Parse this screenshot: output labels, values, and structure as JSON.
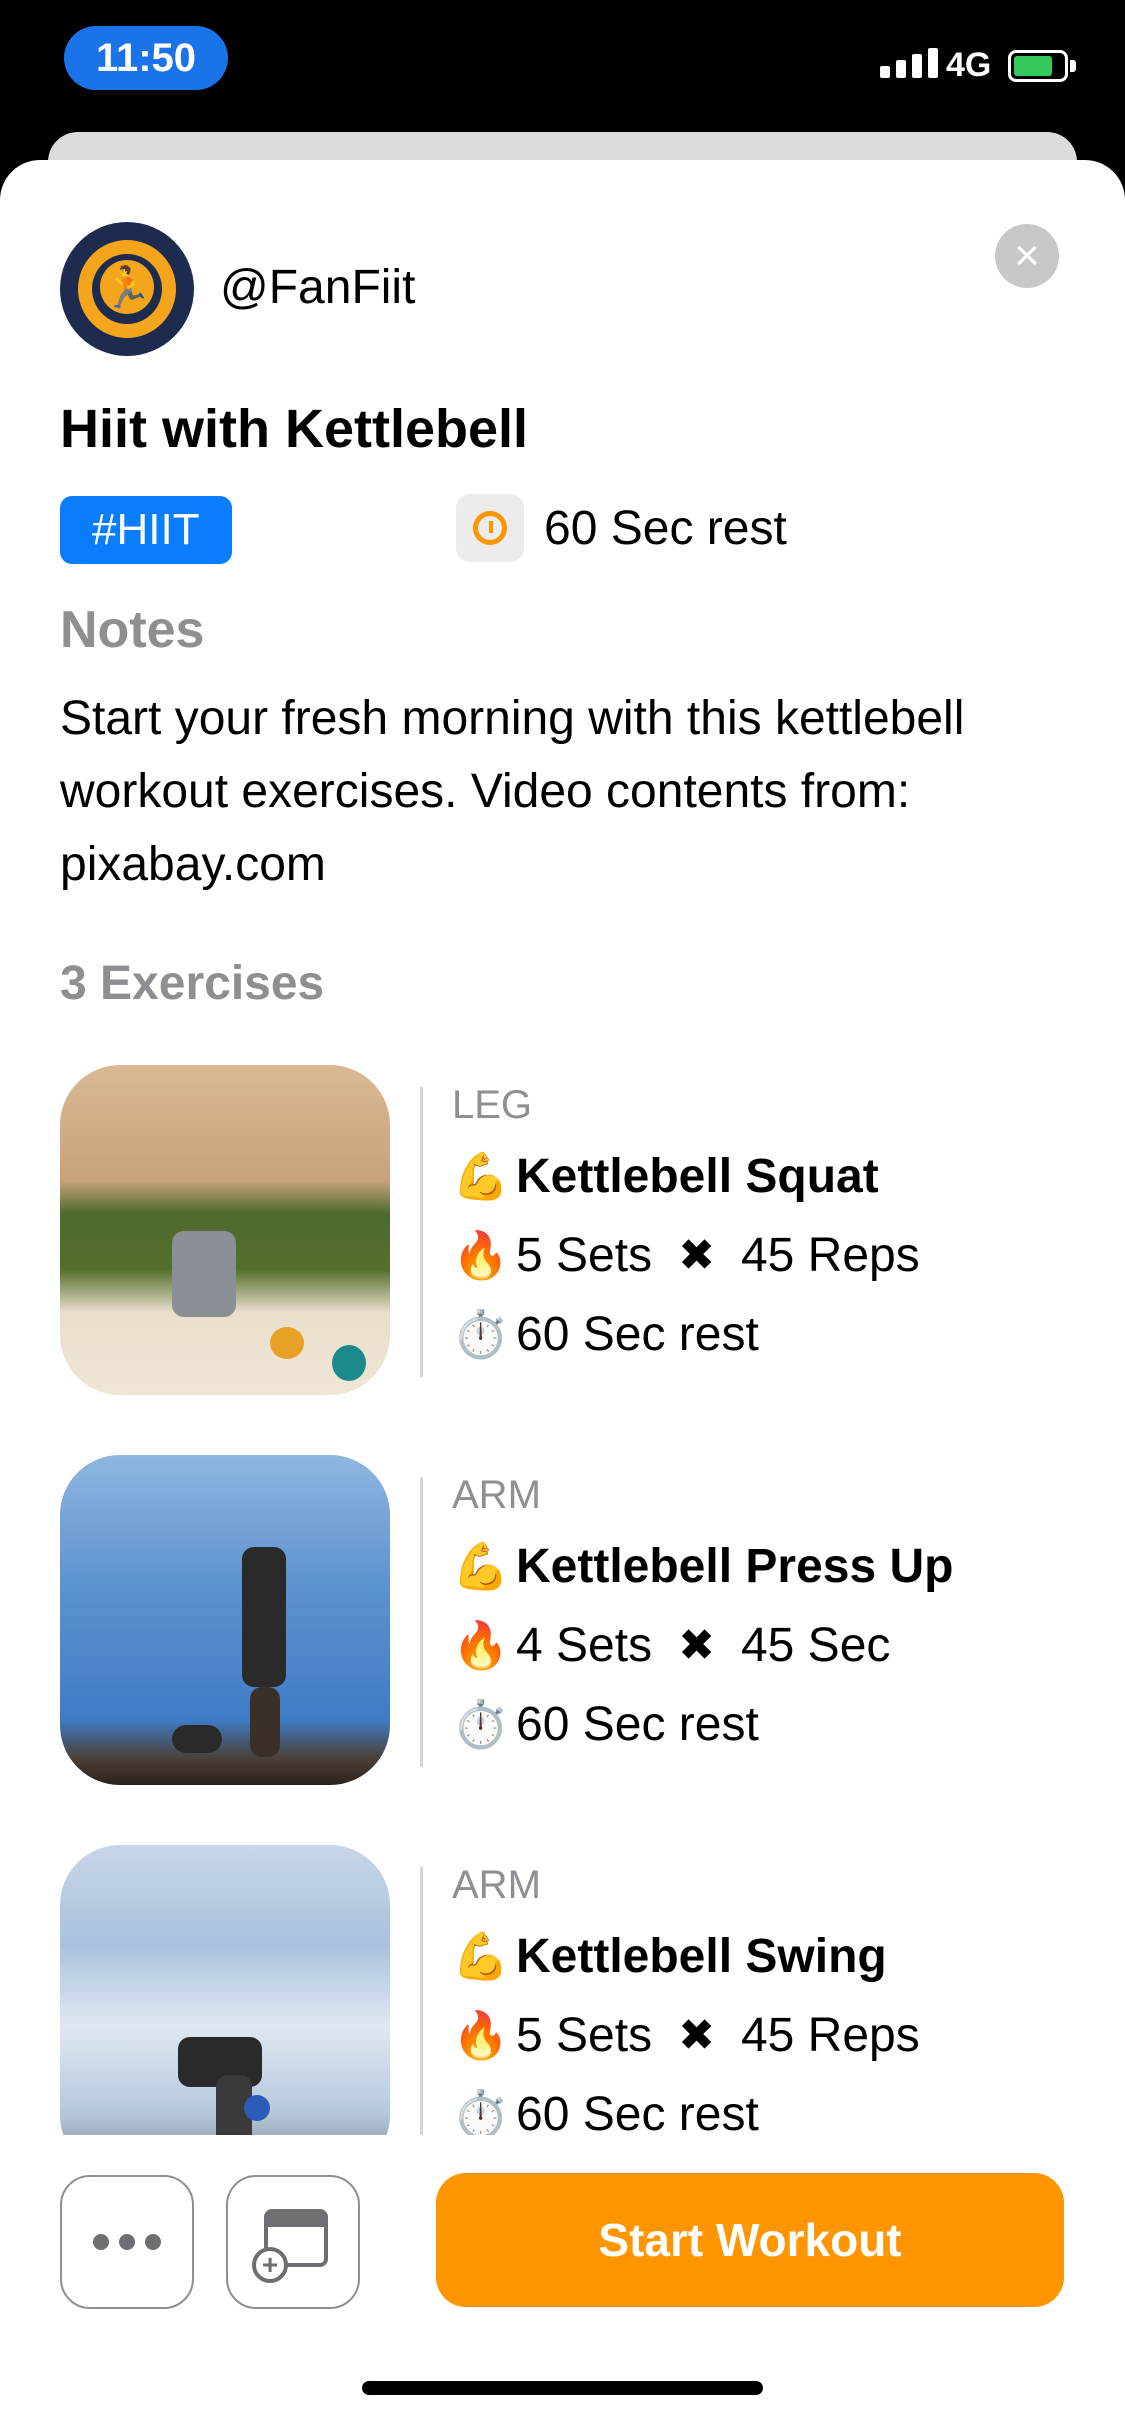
{
  "status_bar": {
    "time": "11:50",
    "network": "4G"
  },
  "header": {
    "handle": "@FanFiit"
  },
  "workout": {
    "title": "Hiit with Kettlebell",
    "tag": "#HIIT",
    "rest": "60 Sec rest",
    "notes_label": "Notes",
    "notes": "Start your fresh morning with this kettlebell workout exercises. Video contents from: pixabay.com",
    "exercise_count": "3 Exercises"
  },
  "exercises": [
    {
      "category": "LEG",
      "name": "Kettlebell Squat",
      "sets": "5 Sets",
      "amount": "45 Reps",
      "rest": "60 Sec rest"
    },
    {
      "category": "ARM",
      "name": "Kettlebell Press Up",
      "sets": "4 Sets",
      "amount": "45 Sec",
      "rest": "60 Sec rest"
    },
    {
      "category": "ARM",
      "name": "Kettlebell Swing",
      "sets": "5 Sets",
      "amount": "45 Reps",
      "rest": "60 Sec rest"
    }
  ],
  "icons": {
    "muscle": "💪",
    "fire": "🔥",
    "stopwatch": "⏱️",
    "times": "✖",
    "close": "×"
  },
  "footer": {
    "start_label": "Start Workout"
  },
  "colors": {
    "accent": "#ff9500",
    "tag": "#0a7dff",
    "time_pill": "#1a73e8"
  }
}
